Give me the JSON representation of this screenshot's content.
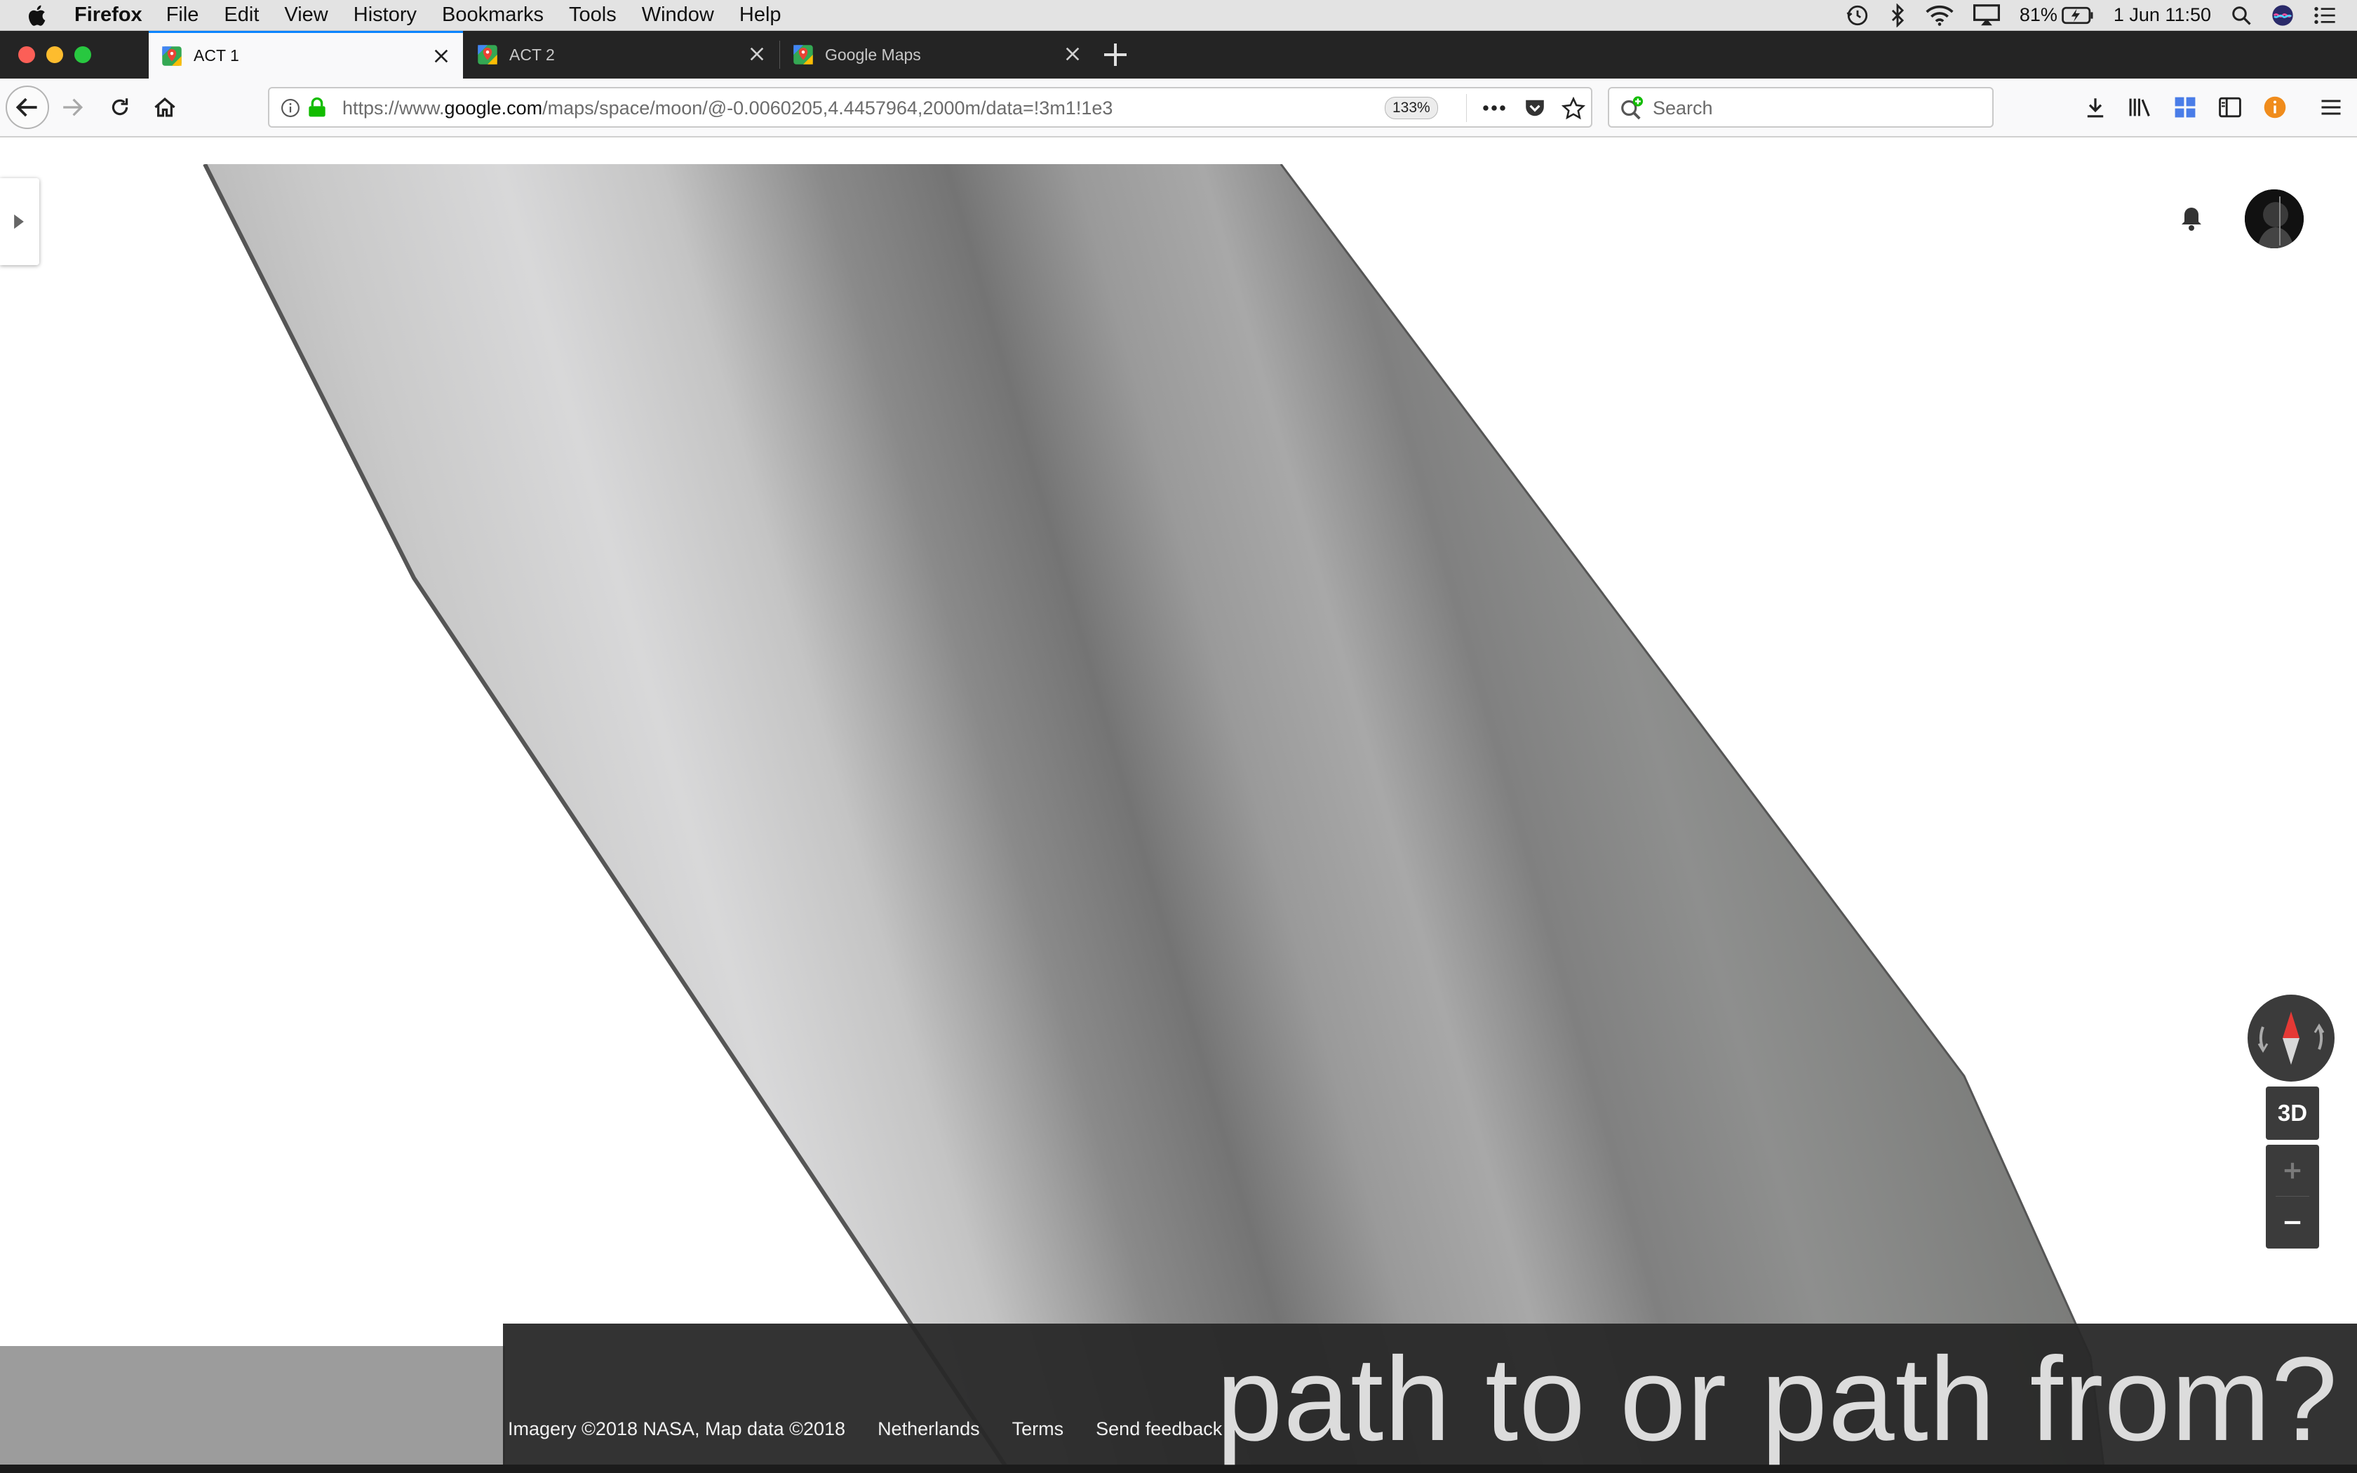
{
  "menubar": {
    "app_name": "Firefox",
    "items": [
      "File",
      "Edit",
      "View",
      "History",
      "Bookmarks",
      "Tools",
      "Window",
      "Help"
    ],
    "battery": "81%",
    "datetime": "1 Jun  11:50"
  },
  "tabs": [
    {
      "label": "ACT 1",
      "active": true
    },
    {
      "label": "ACT 2",
      "active": false
    },
    {
      "label": "Google Maps",
      "active": false
    }
  ],
  "navbar": {
    "url_prefix": "https://www.",
    "url_host": "google.com",
    "url_path": "/maps/space/moon/@-0.0060205,4.4457964,2000m/data=!3m1!1e3",
    "zoom": "133%",
    "search_placeholder": "Search"
  },
  "map": {
    "btn_3d": "3D",
    "zoom_in": "+",
    "zoom_out": "−"
  },
  "footer": {
    "imagery": "Imagery ©2018 NASA, Map data ©2018",
    "region": "Netherlands",
    "terms": "Terms",
    "feedback": "Send feedback"
  },
  "caption": "path to or path from?",
  "colors": {
    "tab_active_accent": "#0a84ff",
    "lock_green": "#12bc00",
    "compass_red": "#e53935",
    "map_surface": "#8c8c8c"
  }
}
